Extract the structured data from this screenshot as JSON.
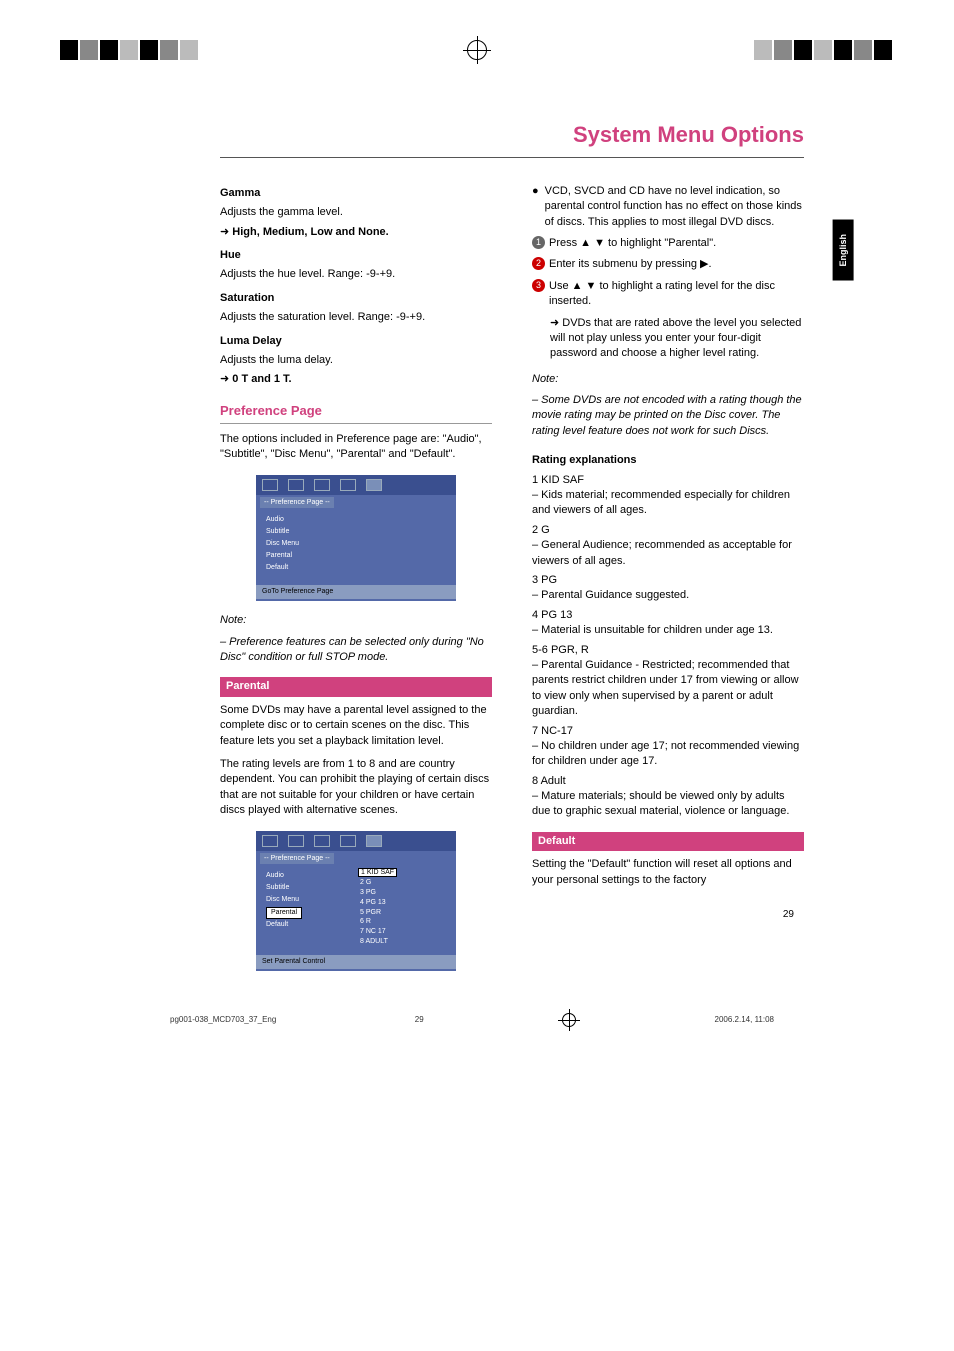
{
  "header": {
    "page_title": "System Menu Options",
    "side_tab": "English"
  },
  "left_col": {
    "gamma": {
      "heading": "Gamma",
      "desc": "Adjusts the gamma level.",
      "options": "High, Medium, Low and None."
    },
    "hue": {
      "heading": "Hue",
      "desc": "Adjusts the hue level. Range: -9-+9."
    },
    "saturation": {
      "heading": "Saturation",
      "desc": "Adjusts the saturation level. Range: -9-+9."
    },
    "luma": {
      "heading": "Luma Delay",
      "desc": "Adjusts the luma delay.",
      "options": "0 T and 1 T."
    },
    "pref_page": {
      "heading": "Preference Page",
      "desc": "The options included in Preference page are: \"Audio\", \"Subtitle\", \"Disc Menu\", \"Parental\" and \"Default\"."
    },
    "menu1": {
      "subtitle": "-- Preference Page --",
      "items": [
        "Audio",
        "Subtitle",
        "Disc Menu",
        "Parental",
        "Default"
      ],
      "footer": "GoTo Preference Page"
    },
    "note1": {
      "label": "Note:",
      "text": "– Preference features can be selected only during \"No Disc\" condition or full STOP mode."
    },
    "parental": {
      "heading": "Parental",
      "p1": "Some DVDs may have a parental level assigned to the complete disc or to certain scenes on the disc. This feature lets you set a playback limitation level.",
      "p2": "The rating levels are from 1 to 8 and are country dependent. You can prohibit the playing of certain discs that are not suitable for your children or have certain discs played with alternative scenes."
    },
    "menu2": {
      "subtitle": "-- Preference Page --",
      "left_items": [
        "Audio",
        "Subtitle",
        "Disc Menu",
        "Parental",
        "Default"
      ],
      "selected_left": "Parental",
      "right_items": [
        "1 KID SAF",
        "2 G",
        "3 PG",
        "4 PG 13",
        "5 PGR",
        "6 R",
        "7 NC 17",
        "8 ADULT"
      ],
      "selected_right": "1 KID SAF",
      "footer": "Set Parental Control"
    }
  },
  "right_col": {
    "bullet": "VCD, SVCD and CD have no level indication, so parental control function has no effect on those kinds of discs. This applies to most illegal DVD discs.",
    "step1": "Press ▲ ▼ to highlight \"Parental\".",
    "step2": "Enter its submenu by pressing ▶.",
    "step3": "Use ▲ ▼ to highlight a rating level for the disc inserted.",
    "step3_sub": "➜ DVDs that are rated above the level you selected will not play unless you enter your four-digit password and choose a higher level rating.",
    "note2": {
      "label": "Note:",
      "text": "– Some DVDs are not encoded with a rating though the movie rating may be printed on the Disc cover. The rating level feature does not work for such Discs."
    },
    "ratings": {
      "heading": "Rating explanations",
      "r1_title": "1 KID SAF",
      "r1_text": "– Kids material; recommended especially for children and viewers of all ages.",
      "r2_title": "2 G",
      "r2_text": "– General Audience; recommended as acceptable for viewers of all ages.",
      "r3_title": "3 PG",
      "r3_text": "– Parental Guidance suggested.",
      "r4_title": "4 PG 13",
      "r4_text": "– Material is unsuitable for children under age 13.",
      "r5_title": "5-6 PGR, R",
      "r5_text": "– Parental Guidance - Restricted; recommended that parents restrict children under 17 from viewing or allow to view only when supervised by a parent or adult guardian.",
      "r6_title": "7 NC-17",
      "r6_text": "– No children under age 17; not recommended viewing for children under age 17.",
      "r7_title": "8 Adult",
      "r7_text": "– Mature materials; should be viewed only by adults due to graphic sexual material, violence or language."
    },
    "default": {
      "heading": "Default",
      "text": "Setting the \"Default\" function will reset all options and your personal settings to the factory"
    },
    "page_num": "29"
  },
  "footer": {
    "file": "pg001-038_MCD703_37_Eng",
    "page": "29",
    "date": "2006.2.14, 11:08"
  }
}
